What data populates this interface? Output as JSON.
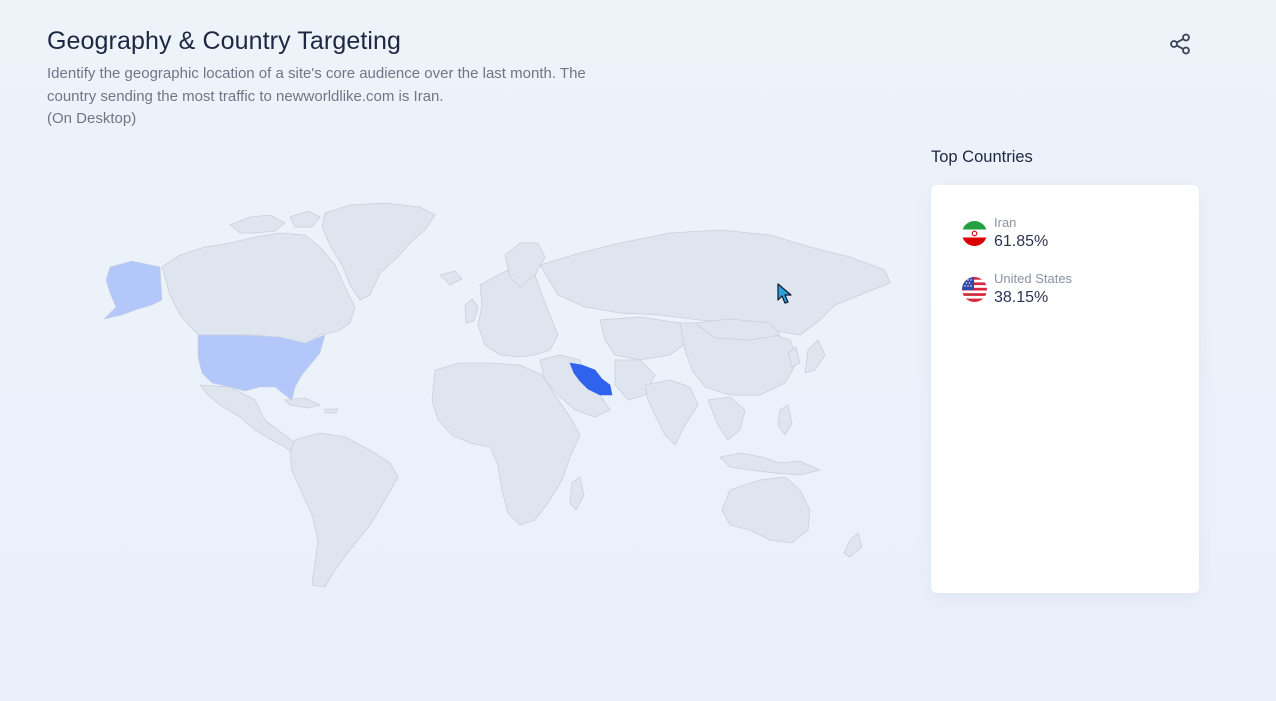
{
  "header": {
    "title": "Geography & Country Targeting",
    "description_line1": "Identify the geographic location of a site's core audience over the last month. The",
    "description_line2": "country sending the most traffic to newworldlike.com is Iran.",
    "description_line3": "(On Desktop)",
    "share_icon": "share-icon"
  },
  "map": {
    "highlight_colors": {
      "base": "#dfe5ef",
      "border": "#c8d0dc",
      "iran": "#2f63ee",
      "united_states": "#b3c7fb"
    }
  },
  "top_countries": {
    "title": "Top Countries",
    "items": [
      {
        "name": "Iran",
        "percent": "61.85%",
        "flag_icon": "iran-flag-icon"
      },
      {
        "name": "United States",
        "percent": "38.15%",
        "flag_icon": "us-flag-icon"
      }
    ]
  }
}
